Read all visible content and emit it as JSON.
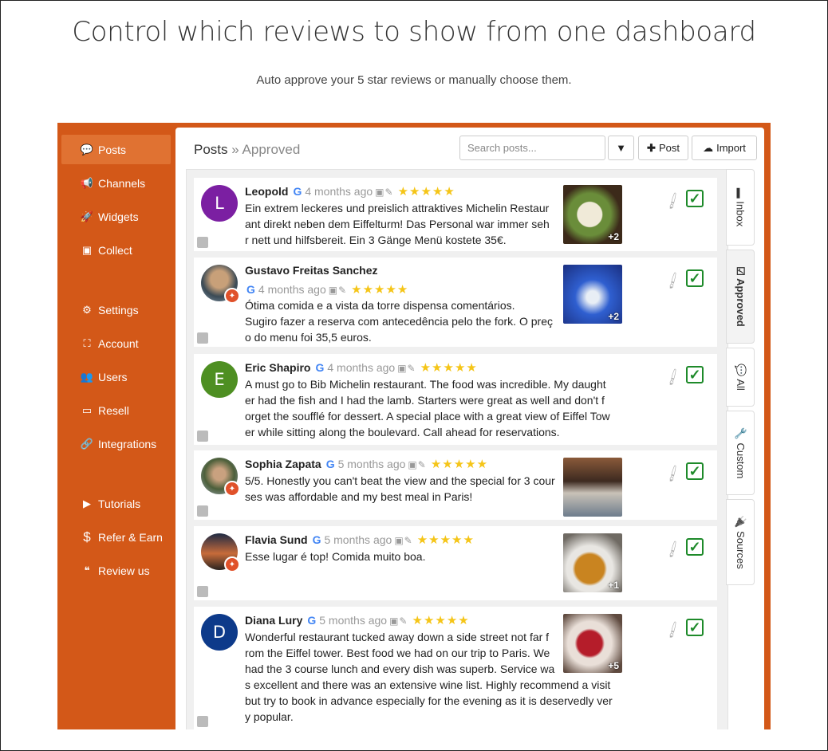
{
  "heading": "Control which reviews to show from one dashboard",
  "subheading": "Auto approve your 5 star reviews or manually choose them.",
  "sidebar": {
    "items": [
      {
        "label": "Posts",
        "icon": "comment-icon",
        "glyph": "💬"
      },
      {
        "label": "Channels",
        "icon": "megaphone-icon",
        "glyph": "📢"
      },
      {
        "label": "Widgets",
        "icon": "rocket-icon",
        "glyph": "🚀"
      },
      {
        "label": "Collect",
        "icon": "archive-icon",
        "glyph": "▣"
      },
      {
        "label": "Settings",
        "icon": "cogs-icon",
        "glyph": "⚙"
      },
      {
        "label": "Account",
        "icon": "sitemap-icon",
        "glyph": "⛶"
      },
      {
        "label": "Users",
        "icon": "users-icon",
        "glyph": "👥"
      },
      {
        "label": "Resell",
        "icon": "credit-card-icon",
        "glyph": "▭"
      },
      {
        "label": "Integrations",
        "icon": "link-icon",
        "glyph": "🔗"
      },
      {
        "label": "Tutorials",
        "icon": "video-icon",
        "glyph": "▶"
      },
      {
        "label": "Refer & Earn",
        "icon": "dollar-icon",
        "glyph": "$"
      },
      {
        "label": "Review us",
        "icon": "quote-icon",
        "glyph": "❝"
      }
    ]
  },
  "header": {
    "title": "Posts",
    "separator": "»",
    "subtitle": "Approved",
    "search_placeholder": "Search posts...",
    "post_label": "Post",
    "import_label": "Import"
  },
  "tabs": [
    {
      "label": "Inbox",
      "glyph": "▬"
    },
    {
      "label": "Approved",
      "glyph": "☑"
    },
    {
      "label": "All",
      "glyph": "💬"
    },
    {
      "label": "Custom",
      "glyph": "🔧"
    },
    {
      "label": "Sources",
      "glyph": "🔌"
    }
  ],
  "reviews": [
    {
      "name": "Leopold",
      "time": "4 months ago",
      "stars": "★★★★★",
      "avatar_letter": "L",
      "avatar_color": "#7b1fa2",
      "text": "Ein extrem leckeres und preislich attraktives Michelin Restaur\nant direkt neben dem Eiffelturm! Das Personal war immer seh\nr nett und hilfsbereit. Ein 3 Gänge Menü kostete 35€.",
      "photo_more": "+2"
    },
    {
      "name": "Gustavo Freitas Sanchez",
      "time": "4 months ago",
      "stars": "★★★★★",
      "text": "Ótima comida e a vista da torre dispensa comentários.\nSugiro fazer a reserva com antecedência pelo the fork. O preç\no do menu foi 35,5 euros.",
      "photo_more": "+2"
    },
    {
      "name": "Eric Shapiro",
      "time": "4 months ago",
      "stars": "★★★★★",
      "avatar_letter": "E",
      "avatar_color": "#4e8f22",
      "text": "A must go to Bib Michelin restaurant. The food was incredible. My daught\ner had the fish and I had the lamb. Starters were great as well and don't f\norget the soufflé for dessert. A special place with a great view of Eiffel Tow\ner while sitting along the boulevard. Call ahead for reservations."
    },
    {
      "name": "Sophia Zapata",
      "time": "5 months ago",
      "stars": "★★★★★",
      "text": "5/5. Honestly you can't beat the view and the special for 3 cour\nses was affordable and my best meal in Paris!"
    },
    {
      "name": "Flavia Sund",
      "time": "5 months ago",
      "stars": "★★★★★",
      "text": "Esse lugar é top! Comida muito boa.",
      "photo_more": "+1"
    },
    {
      "name": "Diana Lury",
      "time": "5 months ago",
      "stars": "★★★★★",
      "avatar_letter": "D",
      "avatar_color": "#0d3a8a",
      "text": "Wonderful restaurant tucked away down a side street not far f\nrom the Eiffel tower. Best food we had on our trip to Paris. We\nhad the 3 course lunch and every dish was superb. Service wa\ns excellent and there was an extensive wine list. Highly recommend a visit\nbut try to book in advance especially for the evening as it is deservedly ver\ny popular.",
      "photo_more": "+5"
    }
  ],
  "colors": {
    "brand": "#d35818",
    "active_nav": "#e07232",
    "approved": "#1e8a2a",
    "star": "#f5c518"
  }
}
